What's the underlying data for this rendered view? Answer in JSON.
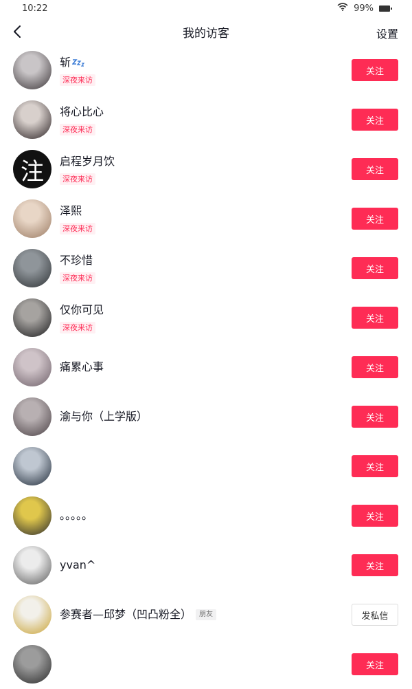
{
  "status": {
    "time": "10:22",
    "battery": "99%"
  },
  "nav": {
    "title": "我的访客",
    "settings": "设置"
  },
  "visitors": [
    {
      "name": "斩",
      "tag": "深夜来访",
      "action": "关注",
      "avatar_colors": [
        "#c9c5c7",
        "#3b3538"
      ]
    },
    {
      "name": "将心比心",
      "tag": "深夜来访",
      "action": "关注",
      "avatar_colors": [
        "#d8d0cc",
        "#2b2224"
      ]
    },
    {
      "name": "启程岁月饮",
      "tag": "深夜来访",
      "action": "关注",
      "avatar_text": "注"
    },
    {
      "name": "泽熙",
      "tag": "深夜来访",
      "action": "关注",
      "avatar_colors": [
        "#e8d6c6",
        "#9a7a62"
      ]
    },
    {
      "name": "不珍惜",
      "tag": "深夜来访",
      "action": "关注",
      "avatar_colors": [
        "#8f959a",
        "#2e3235"
      ]
    },
    {
      "name": "仅你可见",
      "tag": "深夜来访",
      "action": "关注",
      "avatar_colors": [
        "#a6a3a0",
        "#1c1c1e"
      ]
    },
    {
      "name": "痛累心事",
      "tag": "",
      "action": "关注",
      "avatar_colors": [
        "#cfc3c8",
        "#6d5f68"
      ]
    },
    {
      "name": "渝与你（上学版）",
      "tag": "",
      "action": "关注",
      "avatar_colors": [
        "#b8b0b2",
        "#4a4044"
      ]
    },
    {
      "name": "",
      "tag": "",
      "action": "关注",
      "avatar_colors": [
        "#bfc7d1",
        "#1f2a38"
      ]
    },
    {
      "name": "。。。。。",
      "tag": "",
      "action": "关注",
      "avatar_colors": [
        "#e0c74c",
        "#2a2a2c"
      ]
    },
    {
      "name": "yvan^",
      "tag": "",
      "action": "关注",
      "avatar_colors": [
        "#ececec",
        "#5a5a5a"
      ]
    },
    {
      "name": "参赛者—邱梦（凹凸粉全）",
      "tag": "",
      "friend_badge": "朋友",
      "action": "发私信",
      "avatar_colors": [
        "#f2f0ea",
        "#c9a233"
      ]
    },
    {
      "name": "",
      "tag": "",
      "action": "关注",
      "avatar_colors": [
        "#9c9c9c",
        "#2a2a2a"
      ]
    }
  ]
}
